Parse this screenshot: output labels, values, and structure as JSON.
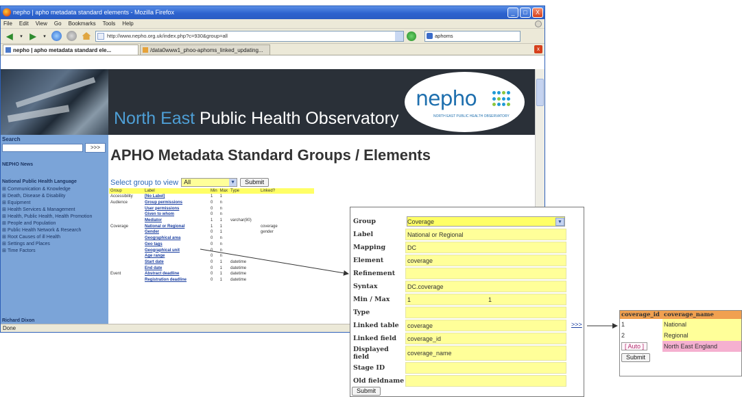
{
  "window": {
    "title": "nepho | apho metadata standard elements - Mozilla Firefox",
    "controls": {
      "minimize": "_",
      "maximize": "□",
      "close": "X"
    }
  },
  "menu": [
    "File",
    "Edit",
    "View",
    "Go",
    "Bookmarks",
    "Tools",
    "Help"
  ],
  "toolbar": {
    "url": "http://www.nepho.org.uk/index.php?c=930&group=all",
    "search_value": "aphoms"
  },
  "tabs": [
    {
      "label": "nepho | apho metadata standard ele...",
      "active": true
    },
    {
      "label": "/data0www1_phoo-aphoms_linked_updating...",
      "active": false
    }
  ],
  "status": "Done",
  "banner": {
    "title_part1": "North East",
    "title_part2": " Public Health Observatory",
    "logo_text": "nepho",
    "logo_subtitle": "NORTH EAST PUBLIC HEALTH OBSERVATORY"
  },
  "sidebar": {
    "search_label": "Search",
    "search_button": ">>>",
    "news_heading": "NEPHO News",
    "library_heading": "National Public Health Language",
    "items": [
      "Communication & Knowledge",
      "Death, Disease & Disability",
      "Equipment",
      "Health Services & Management",
      "Health, Public Health, Health Promotion",
      "People and Population",
      "Public Health Network & Research",
      "Root Causes of ill Health",
      "Settings and Places",
      "Time Factors"
    ],
    "footer_name": "Richard Dixon"
  },
  "main": {
    "heading": "APHO Metadata Standard Groups / Elements",
    "select_label": "Select group to view",
    "select_value": "All",
    "submit_label": "Submit",
    "table_headers": [
      "Group",
      "Label",
      "Min",
      "Max",
      "Type",
      "Linked?"
    ],
    "rows": [
      {
        "group": "Accessibility",
        "label": "[No Label]",
        "min": "1",
        "max": "1",
        "type": "",
        "linked": ""
      },
      {
        "group": "Audience",
        "label": "Group permissions",
        "min": "0",
        "max": "n",
        "type": "",
        "linked": ""
      },
      {
        "group": "",
        "label": "User permissions",
        "min": "0",
        "max": "n",
        "type": "",
        "linked": ""
      },
      {
        "group": "",
        "label": "Given to whom",
        "min": "0",
        "max": "n",
        "type": "",
        "linked": ""
      },
      {
        "group": "",
        "label": "Mediator",
        "min": "1",
        "max": "1",
        "type": "varchar(80)",
        "linked": ""
      },
      {
        "group": "Coverage",
        "label": "National or Regional",
        "min": "1",
        "max": "1",
        "type": "",
        "linked": "coverage"
      },
      {
        "group": "",
        "label": "Gender",
        "min": "0",
        "max": "1",
        "type": "",
        "linked": "gender"
      },
      {
        "group": "",
        "label": "Geographical area",
        "min": "0",
        "max": "n",
        "type": "",
        "linked": ""
      },
      {
        "group": "",
        "label": "Geo tags",
        "min": "0",
        "max": "n",
        "type": "",
        "linked": ""
      },
      {
        "group": "",
        "label": "Geographical unit",
        "min": "0",
        "max": "n",
        "type": "",
        "linked": ""
      },
      {
        "group": "",
        "label": "Age range",
        "min": "0",
        "max": "n",
        "type": "",
        "linked": ""
      },
      {
        "group": "",
        "label": "Start date",
        "min": "0",
        "max": "1",
        "type": "datetime",
        "linked": ""
      },
      {
        "group": "",
        "label": "End date",
        "min": "0",
        "max": "1",
        "type": "datetime",
        "linked": ""
      },
      {
        "group": "Event",
        "label": "Abstract deadline",
        "min": "0",
        "max": "1",
        "type": "datetime",
        "linked": ""
      },
      {
        "group": "",
        "label": "Registration deadline",
        "min": "0",
        "max": "1",
        "type": "datetime",
        "linked": ""
      }
    ]
  },
  "element_panel": {
    "fields": [
      {
        "label": "Group",
        "value": "Coverage"
      },
      {
        "label": "Label",
        "value": "National or Regional"
      },
      {
        "label": "Mapping",
        "value": "DC"
      },
      {
        "label": "Element",
        "value": "coverage"
      },
      {
        "label": "Refinement",
        "value": ""
      },
      {
        "label": "Syntax",
        "value": "DC.coverage"
      },
      {
        "label": "Min / Max",
        "min": "1",
        "max": "1"
      },
      {
        "label": "Type",
        "value": ""
      },
      {
        "label": "Linked table",
        "value": "coverage"
      },
      {
        "label": "Linked field",
        "value": "coverage_id"
      },
      {
        "label": "Displayed field",
        "value": "coverage_name"
      },
      {
        "label": "Stage ID",
        "value": ""
      },
      {
        "label": "Old fieldname",
        "value": ""
      }
    ],
    "link_label": ">>>",
    "submit_label": "Submit"
  },
  "lookup": {
    "headers": [
      "coverage_id",
      "coverage_name"
    ],
    "rows": [
      {
        "id": "1",
        "name": "National"
      },
      {
        "id": "2",
        "name": "Regional"
      }
    ],
    "auto_label": "[ Auto ]",
    "auto_name": "North East England",
    "submit_label": "Submit"
  }
}
